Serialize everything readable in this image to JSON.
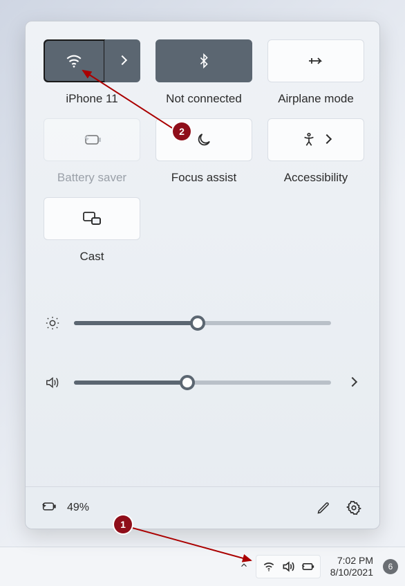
{
  "quick_settings": {
    "tiles": [
      {
        "id": "wifi",
        "label": "iPhone 11",
        "active": true,
        "split": true
      },
      {
        "id": "bluetooth",
        "label": "Not connected",
        "active": true
      },
      {
        "id": "airplane",
        "label": "Airplane mode"
      },
      {
        "id": "battery-saver",
        "label": "Battery saver",
        "disabled": true
      },
      {
        "id": "focus-assist",
        "label": "Focus assist"
      },
      {
        "id": "accessibility",
        "label": "Accessibility",
        "expandable": true
      },
      {
        "id": "cast",
        "label": "Cast"
      }
    ],
    "brightness_pct": 48,
    "volume_pct": 44,
    "battery_text": "49%"
  },
  "taskbar": {
    "time": "7:02 PM",
    "date": "8/10/2021",
    "notification_count": "6"
  },
  "annotations": {
    "step1": "1",
    "step2": "2"
  }
}
